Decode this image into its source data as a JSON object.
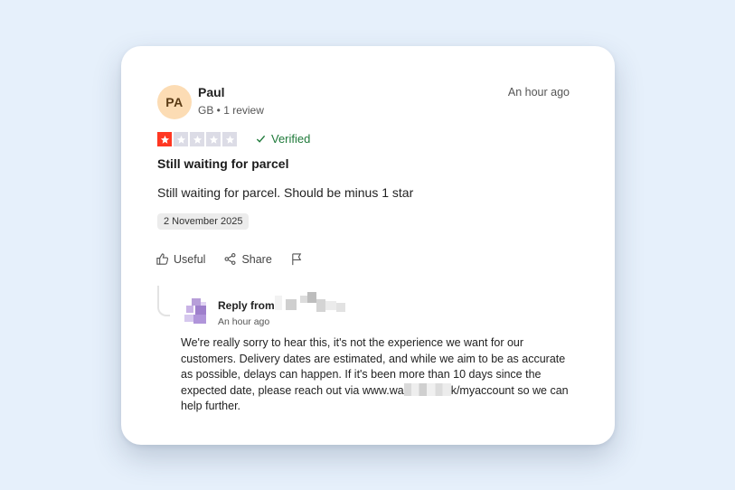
{
  "review": {
    "avatar_initials": "PA",
    "reviewer_name": "Paul",
    "reviewer_meta": "GB • 1 review",
    "posted_time": "An hour ago",
    "rating": 1,
    "rating_max": 5,
    "verified_label": "Verified",
    "title": "Still waiting for parcel",
    "body": "Still waiting for parcel. Should be minus 1 star",
    "experience_date": "2 November 2025"
  },
  "actions": {
    "useful_label": "Useful",
    "share_label": "Share"
  },
  "reply": {
    "from_label": "Reply from",
    "time": "An hour ago",
    "body_before": "We're really sorry to hear this, it's not the experience we want for our customers. Delivery dates are estimated, and while we aim to be as accurate as possible, delays can happen. If it's been more than 10 days since the expected date, please reach out via www.wa",
    "body_after": "k/myaccount so we can help further."
  },
  "colors": {
    "page_bg": "#e6f0fb",
    "star_active": "#ff3722",
    "star_inactive": "#dcdce6",
    "verified": "#1f7a3a",
    "avatar_bg": "#fcdcb4"
  }
}
